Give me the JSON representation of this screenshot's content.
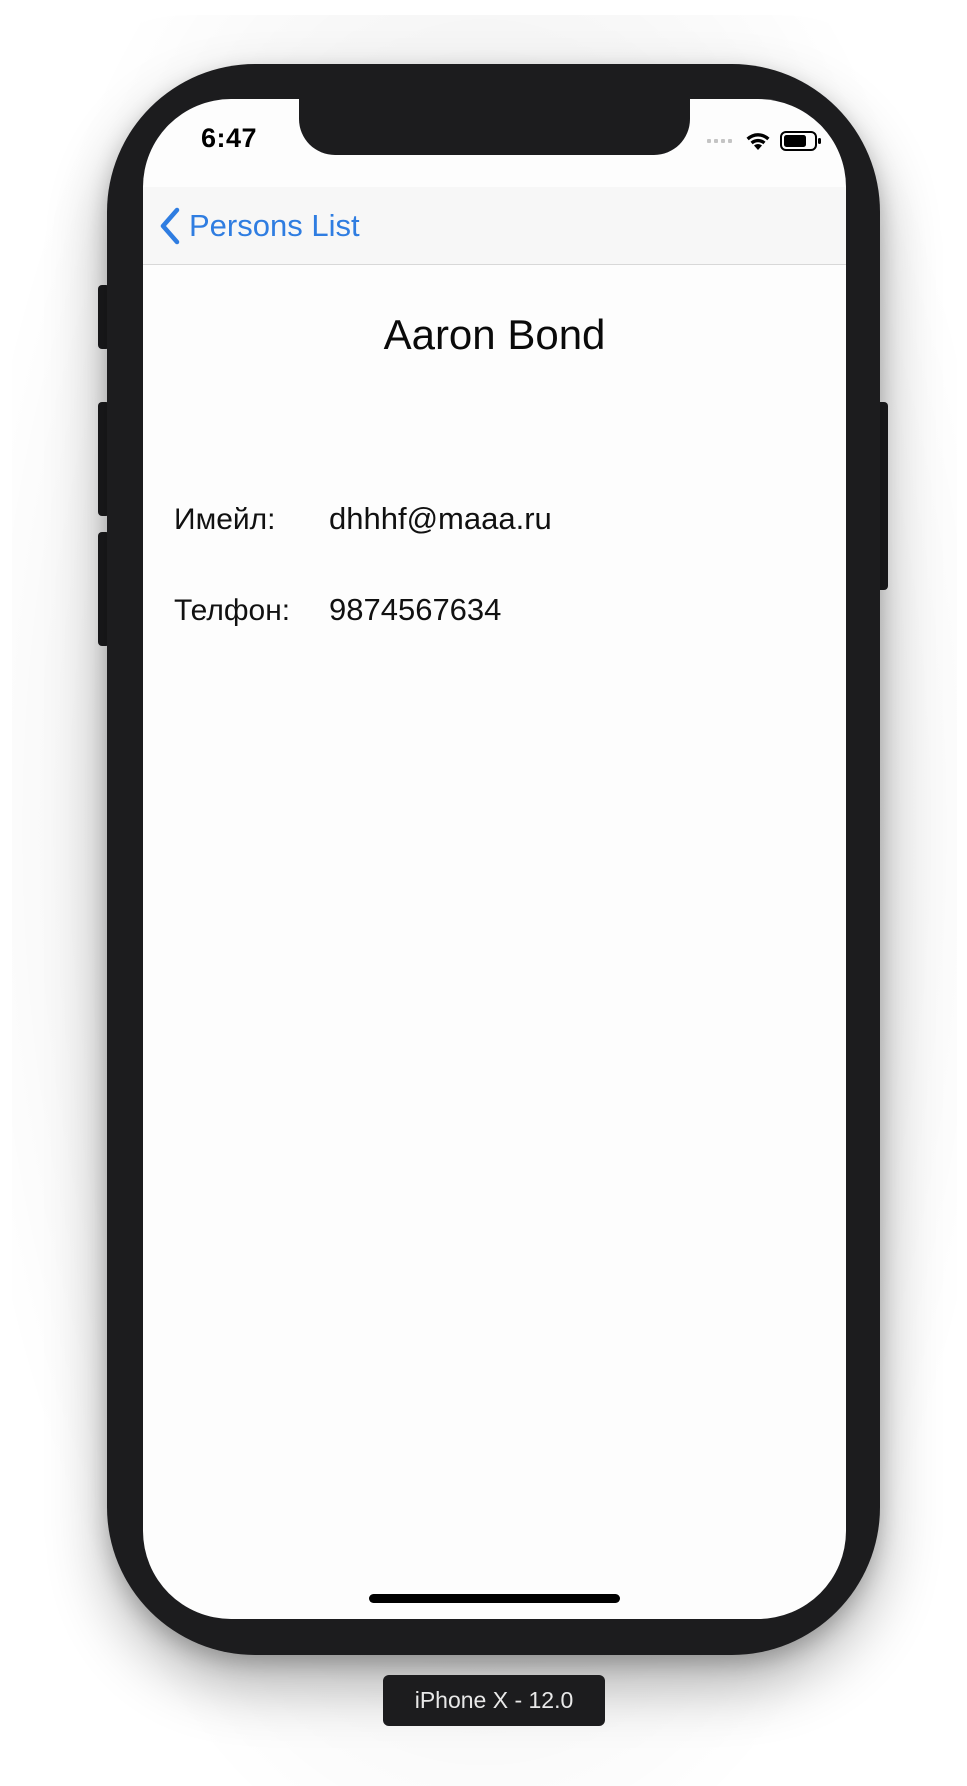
{
  "status_bar": {
    "time": "6:47",
    "icons": [
      "cellular-dots-icon",
      "wifi-icon",
      "battery-icon"
    ]
  },
  "nav_bar": {
    "back_label": "Persons List",
    "back_icon": "chevron-left-icon",
    "accent_color": "#2f7de1"
  },
  "person": {
    "name": "Aaron Bond",
    "fields": [
      {
        "label": "Имейл:",
        "value": "dhhhf@maaa.ru"
      },
      {
        "label": "Телфон:",
        "value": "9874567634"
      }
    ]
  },
  "device": {
    "label": "iPhone X - 12.0"
  }
}
